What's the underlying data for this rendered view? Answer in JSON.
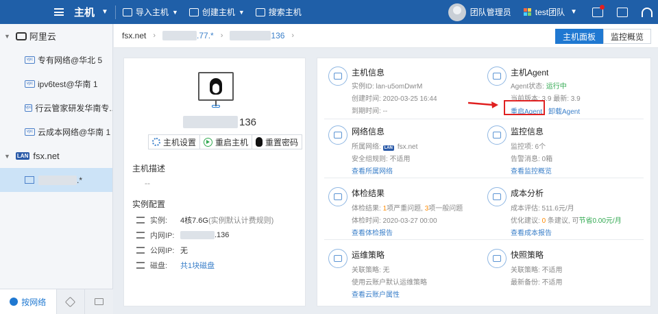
{
  "topbar": {
    "title": "主机",
    "import_label": "导入主机",
    "create_label": "创建主机",
    "search_label": "搜索主机",
    "user": "团队管理员",
    "team": "test团队"
  },
  "sidebar": {
    "group1": "阿里云",
    "items": [
      "专有网络@华北 5",
      "ipv6test@华南 1",
      "行云管家研发华南专...",
      "云成本网络@华南 1"
    ],
    "group2": "fsx.net",
    "host_suffix": ".*",
    "bottom_tab": "按网络"
  },
  "breadcrumb": {
    "c1": "fsx.net",
    "c2": ".77.*",
    "c3": "136",
    "tab_panel": "主机面板",
    "tab_monitor": "监控概览"
  },
  "host": {
    "name_suffix": "136",
    "btn_settings": "主机设置",
    "btn_restart": "重启主机",
    "btn_reset_pwd": "重置密码",
    "desc_label": "主机描述",
    "desc_value": "--",
    "config_label": "实例配置",
    "instance_k": "实例:",
    "instance_v": "4核7.6G",
    "instance_note": "(实例默认计费规则)",
    "private_ip_k": "内网IP:",
    "private_ip_v": ".136",
    "public_ip_k": "公网IP:",
    "public_ip_v": "无",
    "disk_k": "磁盘:",
    "disk_v": "共1块磁盘"
  },
  "cards": {
    "host_info": {
      "title": "主机信息",
      "r1": "实例ID: lan-u5omDwrM",
      "r2": "创建时间: 2020-03-25 16:44",
      "r3": "到期时间: --"
    },
    "agent": {
      "title": "主机Agent",
      "r1_k": "Agent状态: ",
      "r1_v": "运行中",
      "r2": "当前版本: 3.9  最新: 3.9",
      "restart": "重启Agent",
      "uninstall": "卸载Agent"
    },
    "network": {
      "title": "网络信息",
      "r1_k": "所属网络: ",
      "r1_v": "fsx.net",
      "r2": "安全组规则: 不适用",
      "link": "查看所属网络"
    },
    "monitor": {
      "title": "监控信息",
      "r1": "监控项: 6个",
      "r2": "告警消息: 0箱",
      "link": "查看监控概览"
    },
    "check": {
      "title": "体检结果",
      "r1_a": "体检结果: ",
      "r1_n1": "1",
      "r1_b": "项严重问题, ",
      "r1_n2": "3",
      "r1_c": "项一般问题",
      "r2": "体检时间: 2020-03-27 00:00",
      "link": "查看体检报告"
    },
    "cost": {
      "title": "成本分析",
      "r1": "成本评估: 511.6元/月",
      "r2_a": "优化建议: ",
      "r2_n": "0",
      "r2_b": " 条建议, 可",
      "r2_save": "节省0.00元/月",
      "link": "查看成本报告"
    },
    "ops": {
      "title": "运维策略",
      "r1": "关联策略: 无",
      "r2": "使用云账户默认运维策略",
      "link": "查看云账户属性"
    },
    "snapshot": {
      "title": "快照策略",
      "r1": "关联策略: 不适用",
      "r2": "最新备份: 不适用"
    }
  },
  "colors": {
    "topbar": "#1f5fa8",
    "accent": "#1f78d1",
    "link": "#3a7fc9",
    "success": "#2fa84f",
    "warning": "#ff8a00",
    "highlight": "#e02020"
  }
}
